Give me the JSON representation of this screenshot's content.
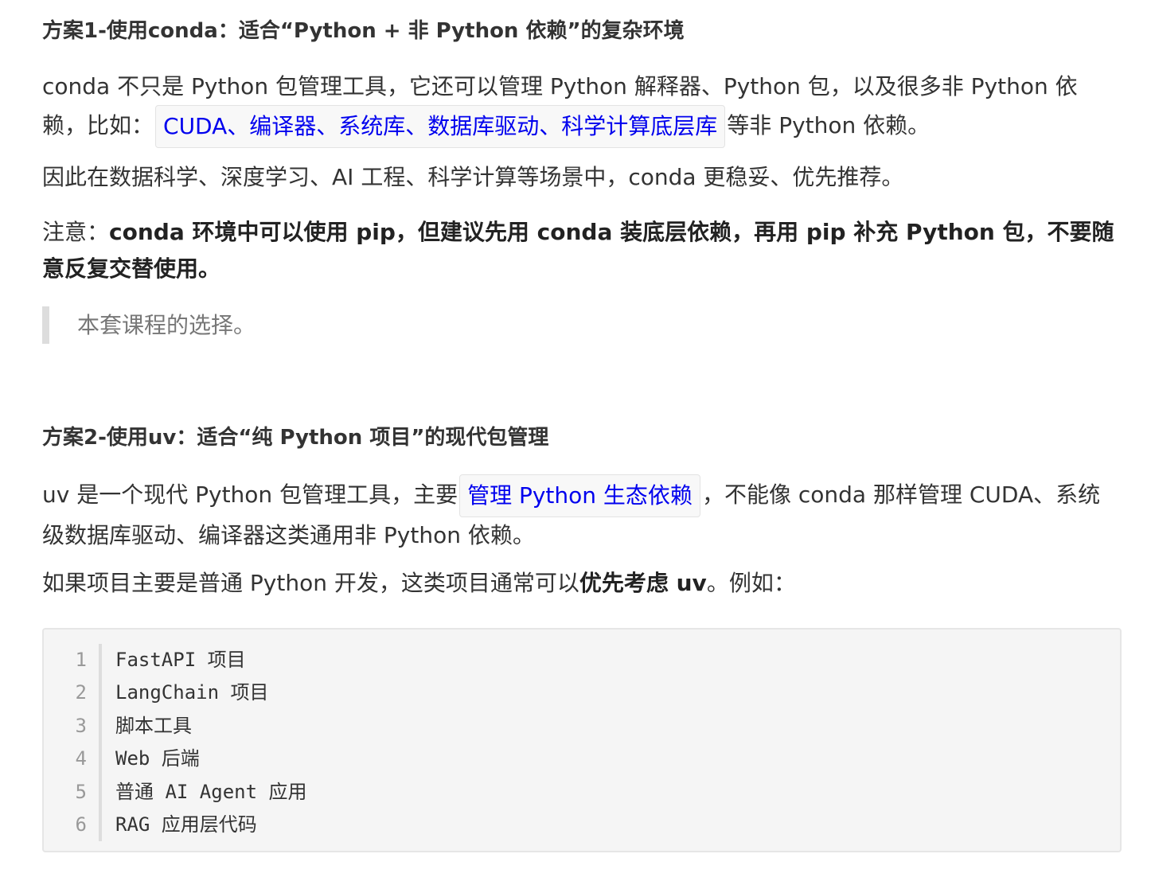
{
  "section1": {
    "heading": "方案1-使用conda：适合“Python + 非 Python 依赖”的复杂环境",
    "para1_a": "conda 不只是 Python 包管理工具，它还可以管理 Python 解释器、Python 包，以及很多非 Python 依赖，比如：",
    "para1_code": "CUDA、编译器、系统库、数据库驱动、科学计算底层库",
    "para1_b": "等非 Python 依赖。",
    "para2": "因此在数据科学、深度学习、AI 工程、科学计算等场景中，conda 更稳妥、优先推荐。",
    "para3_prefix": "注意：",
    "para3_bold": "conda 环境中可以使用 pip，但建议先用 conda 装底层依赖，再用 pip 补充 Python 包，不要随意反复交替使用。",
    "quote": "本套课程的选择。"
  },
  "section2": {
    "heading": "方案2-使用uv：适合“纯 Python 项目”的现代包管理",
    "para1_a": "uv 是一个现代 Python 包管理工具，主要",
    "para1_code": "管理 Python 生态依赖",
    "para1_b": "，不能像 conda 那样管理 CUDA、系统级数据库驱动、编译器这类通用非 Python 依赖。",
    "para2_a": "如果项目主要是普通 Python 开发，这类项目通常可以",
    "para2_bold": "优先考虑 uv",
    "para2_b": "。例如：",
    "code_lines": [
      {
        "num": "1",
        "text": "FastAPI 项目"
      },
      {
        "num": "2",
        "text": "LangChain 项目"
      },
      {
        "num": "3",
        "text": "脚本工具"
      },
      {
        "num": "4",
        "text": "Web 后端"
      },
      {
        "num": "5",
        "text": "普通 AI Agent 应用"
      },
      {
        "num": "6",
        "text": "RAG 应用层代码"
      }
    ]
  }
}
